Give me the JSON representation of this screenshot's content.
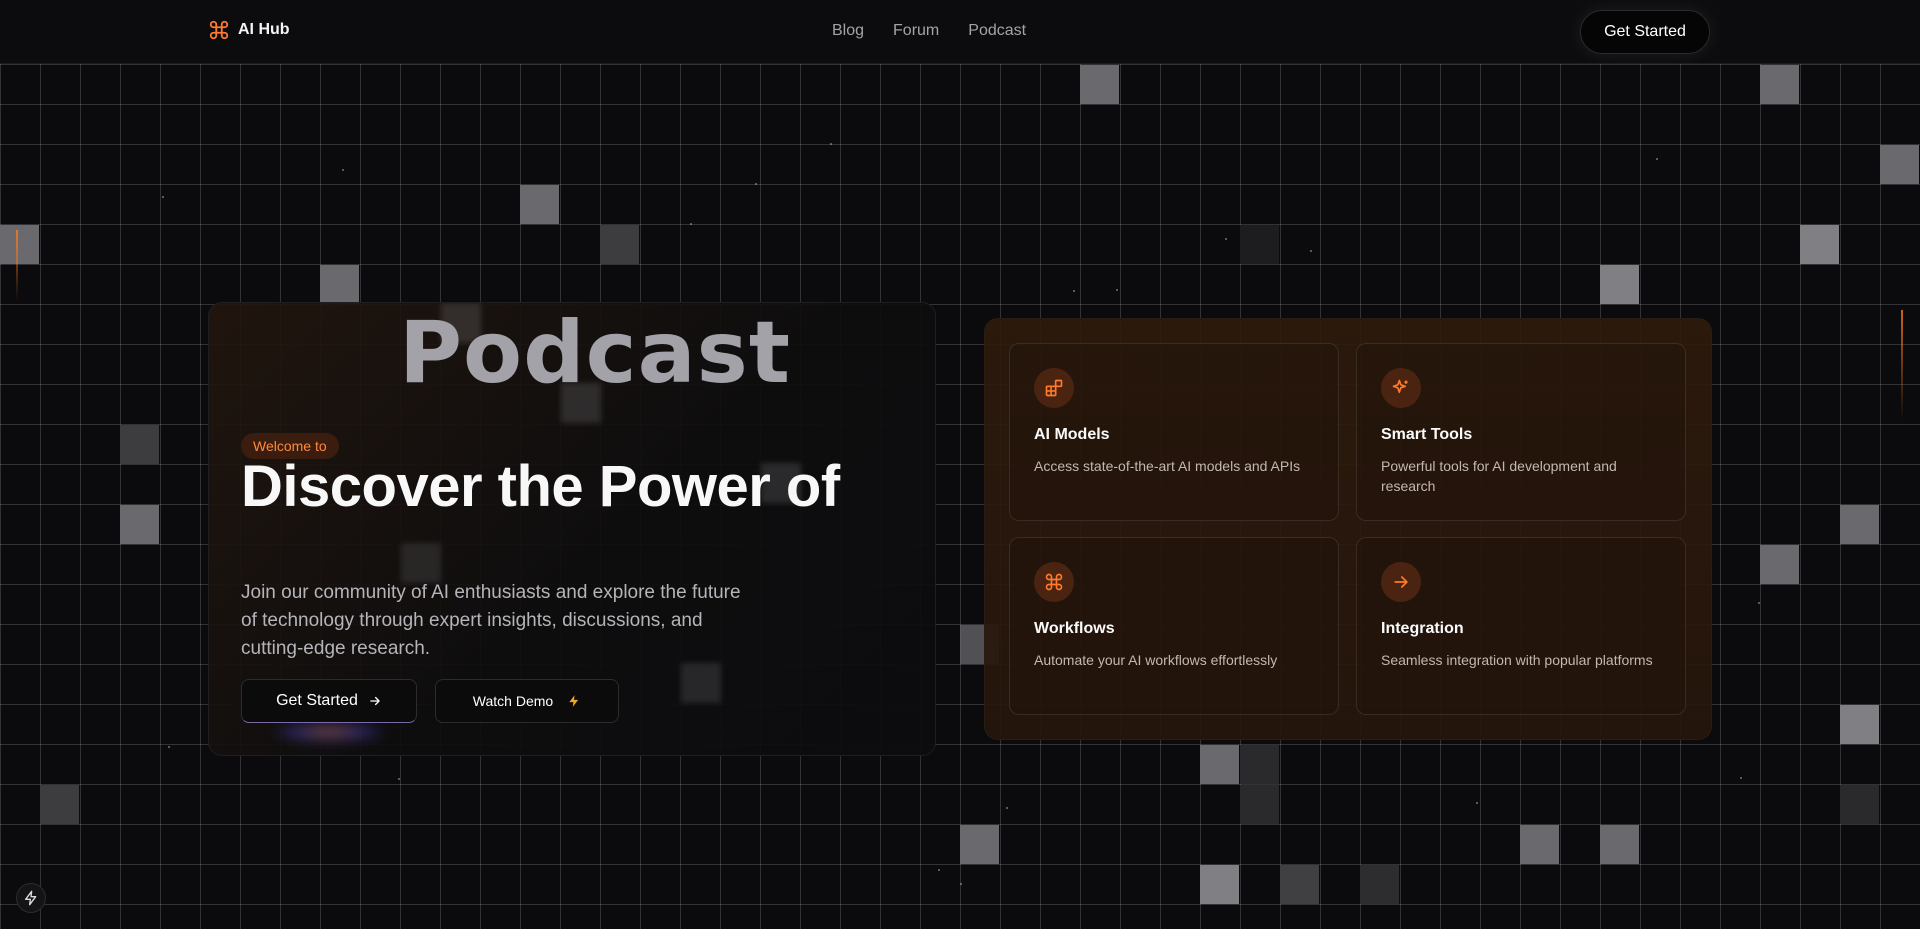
{
  "nav": {
    "brand": "AI Hub",
    "brand_icon": "command-icon",
    "links": [
      "Blog",
      "Forum",
      "Podcast"
    ],
    "cta": "Get Started"
  },
  "hero": {
    "ghost_word": "Podcast",
    "badge": "Welcome to",
    "headline": "Discover the Power of",
    "subtext": "Join our community of AI enthusiasts and explore the future of technology through expert insights, discussions, and cutting-edge research.",
    "primary_button": "Get Started",
    "primary_icon": "arrow-right-icon",
    "secondary_button": "Watch Demo",
    "secondary_icon": "bolt-icon"
  },
  "features": [
    {
      "title": "AI Models",
      "description": "Access state-of-the-art AI models and APIs",
      "icon": "blocks-icon"
    },
    {
      "title": "Smart Tools",
      "description": "Powerful tools for AI development and research",
      "icon": "sparkles-icon"
    },
    {
      "title": "Workflows",
      "description": "Automate your AI workflows effortlessly",
      "icon": "command-icon"
    },
    {
      "title": "Integration",
      "description": "Seamless integration with popular platforms",
      "icon": "arrow-right-circle-icon"
    }
  ],
  "colors": {
    "accent": "#ff7a2a",
    "background": "#0b0b0d",
    "badge_bg": "#3a1d0e"
  },
  "corner_button_icon": "bolt-icon"
}
